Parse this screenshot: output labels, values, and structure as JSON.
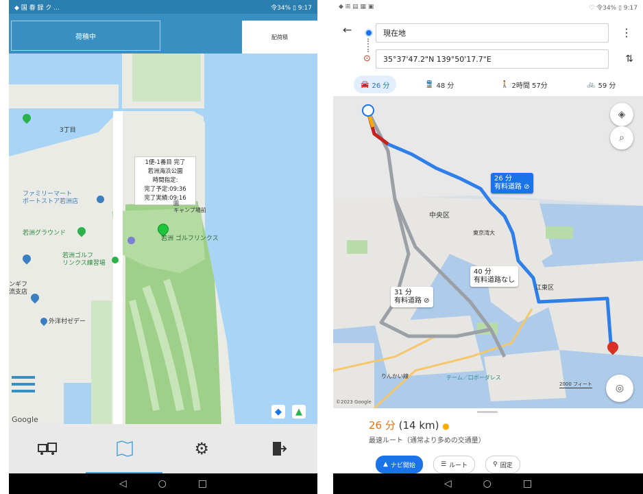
{
  "left": {
    "status": {
      "left": "◆ 国 春 録 ク ...",
      "right": "令34% ▯ 9:17"
    },
    "tabs": {
      "active": "荷積中",
      "inactive": "配荷積"
    },
    "popup": {
      "lines": [
        "1便-1番目 完了",
        "若洲海浜公園",
        "時間指定:",
        "完了予定:09:36",
        "完了実績:09:16"
      ]
    },
    "map_labels": {
      "familymart": "ファミリーマート\nポートストア若洲店",
      "ground": "若洲グラウンド",
      "golf": "若洲ゴルフ\nリンクス練習場",
      "golf_links": "若洲 ゴルフリンクス",
      "shop": "ンギフ\n流支店",
      "marina": "外洋村ゼデー",
      "block": "3丁目",
      "park_label": "園\nキャンプ場前"
    },
    "google": "Google",
    "colors": {
      "header": "#3a8fc2",
      "accent": "#4fa3d6"
    },
    "bottom_icons": [
      "truck-icon",
      "map-icon",
      "gear-icon",
      "exit-icon"
    ]
  },
  "right": {
    "status": {
      "left": "◆ ⊞ ▤ ▦ ▣",
      "right": "♡ 令34% ▯ 9:17"
    },
    "from": "現在地",
    "to": "35°37'47.2\"N 139°50'17.7\"E",
    "modes": [
      {
        "icon": "🚘",
        "label": "26 分",
        "selected": true
      },
      {
        "icon": "🚆",
        "label": "48 分",
        "selected": false
      },
      {
        "icon": "🚶",
        "label": "2時間 57分",
        "selected": false
      },
      {
        "icon": "🚲",
        "label": "59 分",
        "selected": false
      }
    ],
    "callouts": {
      "primary": {
        "time": "26 分",
        "note": "有料道路 ⊘"
      },
      "alt1": {
        "time": "31 分",
        "note": "有料道路 ⊘"
      },
      "alt2": {
        "time": "40 分",
        "note": "有料道路なし"
      }
    },
    "map_labels": {
      "chuo": "中央区",
      "koto": "江東区",
      "tokyo_bay": "東京湾大",
      "rinkai": "りんかい線",
      "tokyo_port": "テーム／口ボーダレス",
      "scale": "2000 フィート",
      "copyright": "©2023 Google"
    },
    "summary": {
      "time": "26 分",
      "distance": "(14 km)",
      "desc": "最速ルート（通常より多めの交通量）"
    },
    "chips": {
      "start": "ナビ開始",
      "steps": "ルート",
      "pin": "固定"
    },
    "colors": {
      "route": "#1a73e8",
      "traffic": "#c5221f",
      "summary_time": "#e8710a"
    }
  }
}
